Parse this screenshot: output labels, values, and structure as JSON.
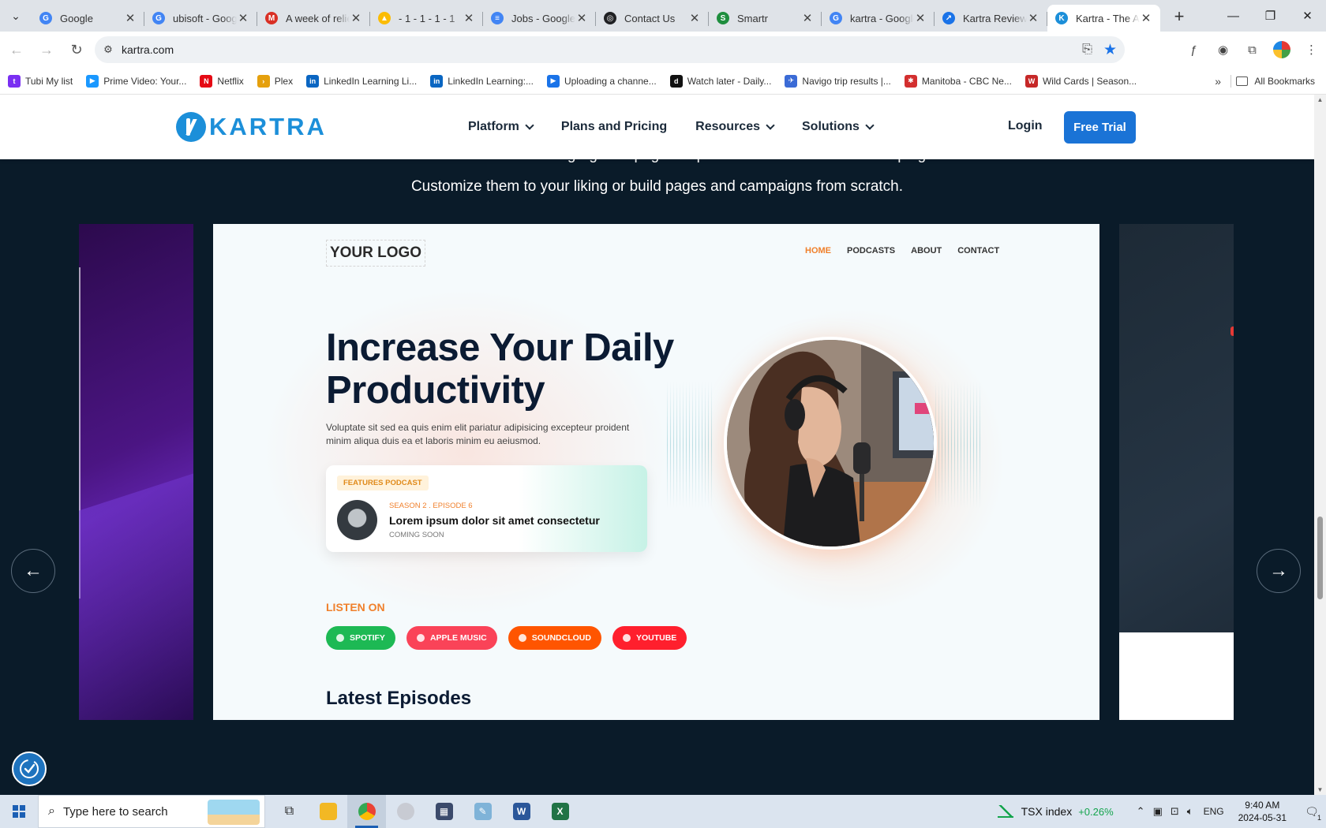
{
  "browser": {
    "tabs": [
      {
        "title": "Google",
        "favicon_color": "#4285f4",
        "favicon_glyph": "G",
        "active": false
      },
      {
        "title": "ubisoft - Google",
        "favicon_color": "#4285f4",
        "favicon_glyph": "G",
        "active": false
      },
      {
        "title": "A week of relief",
        "favicon_color": "#d93025",
        "favicon_glyph": "M",
        "active": false
      },
      {
        "title": "- 1 - 1 - 1 - 1",
        "favicon_color": "#fbbc04",
        "favicon_glyph": "▲",
        "active": false
      },
      {
        "title": "Jobs - Google",
        "favicon_color": "#4285f4",
        "favicon_glyph": "≡",
        "active": false
      },
      {
        "title": "Contact Us",
        "favicon_color": "#202124",
        "favicon_glyph": "◎",
        "active": false
      },
      {
        "title": "Smartr",
        "favicon_color": "#1e8e3e",
        "favicon_glyph": "S",
        "active": false
      },
      {
        "title": "kartra - Google",
        "favicon_color": "#4285f4",
        "favicon_glyph": "G",
        "active": false
      },
      {
        "title": "Kartra Review",
        "favicon_color": "#1a73e8",
        "favicon_glyph": "↗",
        "active": false
      },
      {
        "title": "Kartra - The All",
        "favicon_color": "#1c8fd9",
        "favicon_glyph": "K",
        "active": true
      }
    ],
    "url": "kartra.com",
    "bookmarks": [
      {
        "label": "Tubi My list",
        "color": "#7a2ff2",
        "glyph": "t"
      },
      {
        "label": "Prime Video: Your...",
        "color": "#1a98ff",
        "glyph": "▶"
      },
      {
        "label": "Netflix",
        "color": "#e50914",
        "glyph": "N"
      },
      {
        "label": "Plex",
        "color": "#e5a00d",
        "glyph": "›"
      },
      {
        "label": "LinkedIn Learning Li...",
        "color": "#0a66c2",
        "glyph": "in"
      },
      {
        "label": "LinkedIn Learning:...",
        "color": "#0a66c2",
        "glyph": "in"
      },
      {
        "label": "Uploading a channe...",
        "color": "#1a73e8",
        "glyph": "▶"
      },
      {
        "label": "Watch later - Daily...",
        "color": "#111111",
        "glyph": "d"
      },
      {
        "label": "Navigo trip results |...",
        "color": "#3b6bd6",
        "glyph": "✈"
      },
      {
        "label": "Manitoba - CBC Ne...",
        "color": "#d32f2f",
        "glyph": "✱"
      },
      {
        "label": "Wild Cards | Season...",
        "color": "#c62828",
        "glyph": "W"
      }
    ],
    "all_bookmarks_label": "All Bookmarks"
  },
  "site": {
    "logo_text": "KARTRA",
    "nav": [
      {
        "label": "Platform",
        "dropdown": true
      },
      {
        "label": "Plans and Pricing",
        "dropdown": false
      },
      {
        "label": "Resources",
        "dropdown": true
      },
      {
        "label": "Solutions",
        "dropdown": true
      }
    ],
    "login_label": "Login",
    "cta_label": "Free Trial",
    "intro_line1": "Choose from hundreds of our gorgeous page templates and Done For You Campaigns.",
    "intro_line2": "Customize them to your liking or build pages and campaigns from scratch."
  },
  "template_preview": {
    "logo_placeholder": "YOUR LOGO",
    "nav": [
      "HOME",
      "PODCASTS",
      "ABOUT",
      "CONTACT"
    ],
    "headline_line1": "Increase Your Daily",
    "headline_line2": "Productivity",
    "paragraph": "Voluptate sit sed ea quis enim elit pariatur adipisicing excepteur proident minim aliqua duis ea et laboris minim eu aeiusmod.",
    "featured": {
      "badge": "FEATURES PODCAST",
      "episode": "SEASON 2 . EPISODE 6",
      "title": "Lorem ipsum dolor sit amet consectetur",
      "status": "COMING SOON"
    },
    "listen_on_label": "LISTEN ON",
    "platforms": [
      {
        "label": "SPOTIFY",
        "color": "#1db954"
      },
      {
        "label": "APPLE MUSIC",
        "color": "#fa4358"
      },
      {
        "label": "SOUNDCLOUD",
        "color": "#ff5500"
      },
      {
        "label": "YOUTUBE",
        "color": "#ff1f2d"
      }
    ],
    "latest_episodes_label": "Latest Episodes"
  },
  "taskbar": {
    "search_placeholder": "Type here to search",
    "ticker_name": "TSX index",
    "ticker_change": "+0.26%",
    "language": "ENG",
    "time": "9:40 AM",
    "date": "2024-05-31",
    "notification_count": "1"
  }
}
